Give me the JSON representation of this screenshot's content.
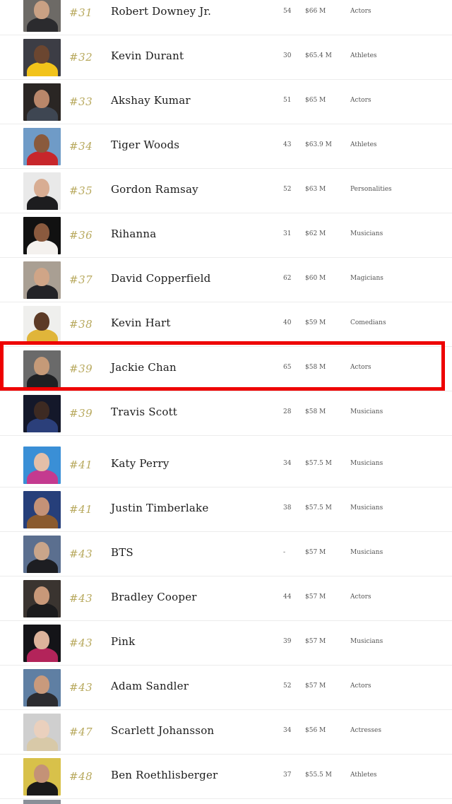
{
  "rows": [
    {
      "rank": "#31",
      "name": "Robert Downey Jr.",
      "age": "54",
      "earnings": "$66 M",
      "category": "Actors",
      "avatar": {
        "skin": "#c9a184",
        "clothes": "#2b2b2e",
        "bg": "#6d6a66"
      }
    },
    {
      "rank": "#32",
      "name": "Kevin Durant",
      "age": "30",
      "earnings": "$65.4 M",
      "category": "Athletes",
      "avatar": {
        "skin": "#6b4630",
        "clothes": "#f2c31a",
        "bg": "#3c3d45"
      }
    },
    {
      "rank": "#33",
      "name": "Akshay Kumar",
      "age": "51",
      "earnings": "$65 M",
      "category": "Actors",
      "avatar": {
        "skin": "#b9876a",
        "clothes": "#3e4652",
        "bg": "#2a2624"
      }
    },
    {
      "rank": "#34",
      "name": "Tiger Woods",
      "age": "43",
      "earnings": "$63.9 M",
      "category": "Athletes",
      "avatar": {
        "skin": "#8a5a3c",
        "clothes": "#c7262b",
        "bg": "#6f9bc7"
      }
    },
    {
      "rank": "#35",
      "name": "Gordon Ramsay",
      "age": "52",
      "earnings": "$63 M",
      "category": "Personalities",
      "avatar": {
        "skin": "#d8ad93",
        "clothes": "#1d1d1f",
        "bg": "#e9e9e9"
      }
    },
    {
      "rank": "#36",
      "name": "Rihanna",
      "age": "31",
      "earnings": "$62 M",
      "category": "Musicians",
      "avatar": {
        "skin": "#8a5a3e",
        "clothes": "#f4f1ee",
        "bg": "#111111"
      }
    },
    {
      "rank": "#37",
      "name": "David Copperfield",
      "age": "62",
      "earnings": "$60 M",
      "category": "Magicians",
      "avatar": {
        "skin": "#d0a587",
        "clothes": "#232327",
        "bg": "#a99f93"
      }
    },
    {
      "rank": "#38",
      "name": "Kevin Hart",
      "age": "40",
      "earnings": "$59 M",
      "category": "Comedians",
      "avatar": {
        "skin": "#5c3a26",
        "clothes": "#e0b53a",
        "bg": "#efefed"
      }
    },
    {
      "rank": "#39",
      "name": "Jackie Chan",
      "age": "65",
      "earnings": "$58 M",
      "category": "Actors",
      "avatar": {
        "skin": "#c59a78",
        "clothes": "#1f2023",
        "bg": "#6a6a6a"
      }
    },
    {
      "rank": "#39",
      "name": "Travis Scott",
      "age": "28",
      "earnings": "$58 M",
      "category": "Musicians",
      "avatar": {
        "skin": "#3d2a22",
        "clothes": "#2b3f7a",
        "bg": "#14182a"
      }
    },
    {
      "rank": "#41",
      "name": "Katy Perry",
      "age": "34",
      "earnings": "$57.5 M",
      "category": "Musicians",
      "avatar": {
        "skin": "#e3bfa8",
        "clothes": "#c43a8f",
        "bg": "#3a8fd6"
      }
    },
    {
      "rank": "#41",
      "name": "Justin Timberlake",
      "age": "38",
      "earnings": "$57.5 M",
      "category": "Musicians",
      "avatar": {
        "skin": "#c49277",
        "clothes": "#8a5a2e",
        "bg": "#263f7a"
      }
    },
    {
      "rank": "#43",
      "name": "BTS",
      "age": "-",
      "earnings": "$57 M",
      "category": "Musicians",
      "avatar": {
        "skin": "#c9a58a",
        "clothes": "#1d1e22",
        "bg": "#5b6f8f"
      }
    },
    {
      "rank": "#43",
      "name": "Bradley Cooper",
      "age": "44",
      "earnings": "$57 M",
      "category": "Actors",
      "avatar": {
        "skin": "#c89879",
        "clothes": "#1b1b1d",
        "bg": "#3a3430"
      }
    },
    {
      "rank": "#43",
      "name": "Pink",
      "age": "39",
      "earnings": "$57 M",
      "category": "Musicians",
      "avatar": {
        "skin": "#dcb39b",
        "clothes": "#b3245a",
        "bg": "#141418"
      }
    },
    {
      "rank": "#43",
      "name": "Adam Sandler",
      "age": "52",
      "earnings": "$57 M",
      "category": "Actors",
      "avatar": {
        "skin": "#c99a7c",
        "clothes": "#2c2c30",
        "bg": "#5f7fa3"
      }
    },
    {
      "rank": "#47",
      "name": "Scarlett Johansson",
      "age": "34",
      "earnings": "$56 M",
      "category": "Actresses",
      "avatar": {
        "skin": "#ead0bd",
        "clothes": "#d8c9a8",
        "bg": "#cfcfcf"
      }
    },
    {
      "rank": "#48",
      "name": "Ben Roethlisberger",
      "age": "37",
      "earnings": "$55.5 M",
      "category": "Athletes",
      "avatar": {
        "skin": "#c49277",
        "clothes": "#1a1a1a",
        "bg": "#d8c14a"
      }
    }
  ],
  "highlighted_row": 8,
  "gap_before_row": 10,
  "colors": {
    "rank_gold": "#b8a95e",
    "highlight_red": "#ee0000",
    "row_divider": "#ececec"
  }
}
